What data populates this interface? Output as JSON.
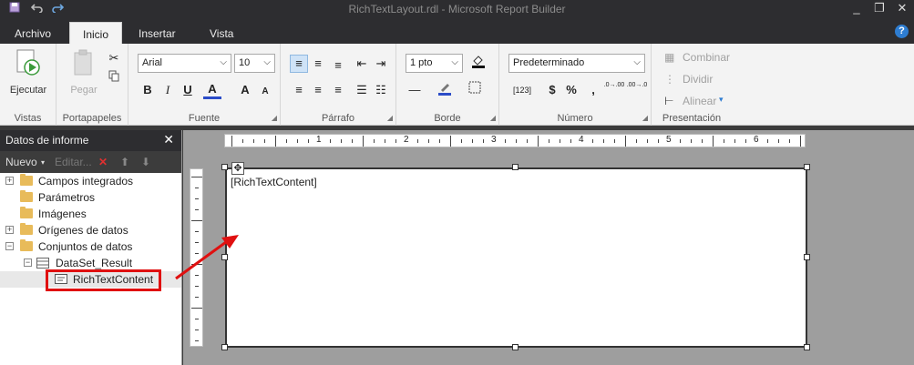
{
  "window": {
    "title": "RichTextLayout.rdl - Microsoft Report Builder",
    "minimize": "_",
    "restore": "❐",
    "close": "✕"
  },
  "quick_access": {
    "save_icon": "save-icon",
    "undo_icon": "undo-icon",
    "redo_icon": "redo-icon"
  },
  "tabs": [
    "Archivo",
    "Inicio",
    "Insertar",
    "Vista"
  ],
  "help_label": "?",
  "ribbon": {
    "vistas": {
      "label": "Vistas",
      "ejecutar": "Ejecutar"
    },
    "portapapeles": {
      "label": "Portapapeles",
      "pegar": "Pegar"
    },
    "fuente": {
      "label": "Fuente",
      "font_name": "Arial",
      "font_size": "10",
      "bold": "B",
      "italic": "I",
      "underline": "U",
      "font_color": "A",
      "grow": "A",
      "shrink": "A"
    },
    "parrafo": {
      "label": "Párrafo"
    },
    "borde": {
      "label": "Borde",
      "border_width": "1 pto"
    },
    "numero": {
      "label": "Número",
      "format": "Predeterminado",
      "placeholder_btn": "[123]",
      "currency": "$",
      "percent": "%",
      "comma": ",",
      "inc_dec": ".0→.00",
      "dec_dec": ".00→.0"
    },
    "presentacion": {
      "label": "Presentación",
      "combinar": "Combinar",
      "dividir": "Dividir",
      "alinear": "Alinear"
    }
  },
  "report_data_panel": {
    "title": "Datos de informe",
    "close": "✕",
    "nuevo": "Nuevo",
    "editar": "Editar...",
    "tree": [
      {
        "label": "Campos integrados",
        "expander": "+"
      },
      {
        "label": "Parámetros",
        "expander": ""
      },
      {
        "label": "Imágenes",
        "expander": ""
      },
      {
        "label": "Orígenes de datos",
        "expander": "+"
      },
      {
        "label": "Conjuntos de datos",
        "expander": "−"
      },
      {
        "label": "DataSet_Result",
        "expander": "−"
      },
      {
        "label": "RichTextContent",
        "expander": ""
      }
    ]
  },
  "ruler": {
    "numbers": [
      "1",
      "2",
      "3",
      "4",
      "5",
      "6"
    ]
  },
  "report": {
    "textbox_content": "[RichTextContent]"
  },
  "colors": {
    "accent": "#2e7dd1",
    "highlight": "#e01010",
    "folder": "#e8bb5a",
    "dark": "#2d2d30"
  }
}
